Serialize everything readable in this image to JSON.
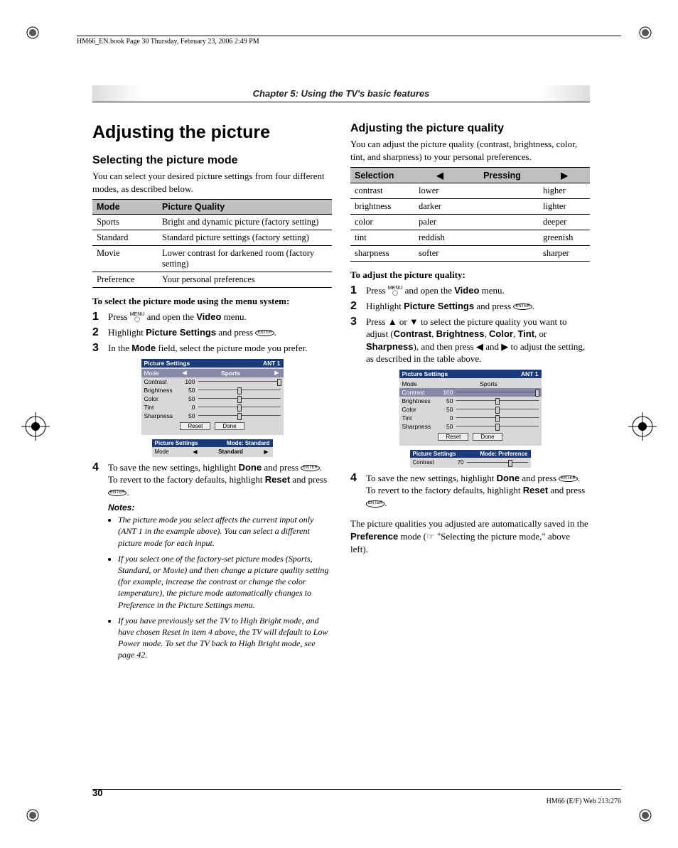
{
  "header_line": "HM66_EN.book  Page 30  Thursday, February 23, 2006  2:49 PM",
  "chapter": "Chapter 5: Using the TV's basic features",
  "page_number": "30",
  "footer_right": "HM66 (E/F) Web 213:276",
  "left": {
    "h1": "Adjusting the picture",
    "h2": "Selecting the picture mode",
    "intro": "You can select your desired picture settings from four different modes, as described below.",
    "table_headers": {
      "c1": "Mode",
      "c2": "Picture Quality"
    },
    "table_rows": [
      {
        "c1": "Sports",
        "c2": "Bright and dynamic picture (factory setting)"
      },
      {
        "c1": "Standard",
        "c2": "Standard picture settings (factory setting)"
      },
      {
        "c1": "Movie",
        "c2": "Lower contrast for darkened room (factory setting)"
      },
      {
        "c1": "Preference",
        "c2": "Your personal preferences"
      }
    ],
    "howto_head": "To select the picture mode using the menu system:",
    "steps": {
      "s1a": "Press ",
      "s1b": " and open the ",
      "s1c": "Video",
      "s1d": " menu.",
      "s2a": "Highlight ",
      "s2b": "Picture Settings",
      "s2c": " and press ",
      "s3a": "In the ",
      "s3b": "Mode",
      "s3c": " field, select the picture mode you prefer.",
      "s4a": "To save the new settings, highlight ",
      "s4b": "Done",
      "s4c": " and press ",
      "s4d": ". To revert to the factory defaults, highlight ",
      "s4e": "Reset",
      "s4f": " and press "
    },
    "notes_head": "Notes:",
    "notes": [
      "The picture mode you select affects the current input only (ANT 1 in the example above). You can select a different picture mode for each input.",
      "If you select one of the factory-set picture modes (Sports, Standard, or Movie) and then change a picture quality setting (for example, increase the contrast or change the color temperature), the picture mode automatically changes to Preference in the Picture Settings menu.",
      "If you have previously set the TV to High Bright mode, and have chosen Reset in item 4 above, the TV will default to Low Power mode. To set the TV back to High Bright mode, see page 42."
    ],
    "osd1": {
      "title_l": "Picture Settings",
      "title_r": "ANT 1",
      "rows": [
        {
          "lab": "Mode",
          "val": "",
          "mode_val": "Sports"
        },
        {
          "lab": "Contrast",
          "val": "100",
          "pos": 100
        },
        {
          "lab": "Brightness",
          "val": "50",
          "pos": 50
        },
        {
          "lab": "Color",
          "val": "50",
          "pos": 50
        },
        {
          "lab": "Tint",
          "val": "0",
          "pos": 50
        },
        {
          "lab": "Sharpness",
          "val": "50",
          "pos": 50
        }
      ],
      "btn_reset": "Reset",
      "btn_done": "Done"
    },
    "osd1b": {
      "title_l": "Picture Settings",
      "title_r": "Mode: Standard",
      "row_lab": "Mode",
      "row_val": "Standard"
    }
  },
  "right": {
    "h2": "Adjusting the picture quality",
    "intro": "You can adjust the picture quality (contrast, brightness, color, tint, and sharpness) to your personal preferences.",
    "table_headers": {
      "c1": "Selection",
      "c2": "◀",
      "c3": "Pressing",
      "c4": "▶"
    },
    "table_rows": [
      {
        "c1": "contrast",
        "c2": "lower",
        "c3": "higher"
      },
      {
        "c1": "brightness",
        "c2": "darker",
        "c3": "lighter"
      },
      {
        "c1": "color",
        "c2": "paler",
        "c3": "deeper"
      },
      {
        "c1": "tint",
        "c2": "reddish",
        "c3": "greenish"
      },
      {
        "c1": "sharpness",
        "c2": "softer",
        "c3": "sharper"
      }
    ],
    "howto_head": "To adjust the picture quality:",
    "steps": {
      "s1a": "Press ",
      "s1b": " and open the ",
      "s1c": "Video",
      "s1d": " menu.",
      "s2a": "Highlight ",
      "s2b": "Picture Settings",
      "s2c": " and press ",
      "s3a": "Press ",
      "s3b": " or ",
      "s3c": " to select the picture quality you want to adjust (",
      "s3d": "Contrast",
      "s3e": ", ",
      "s3f": "Brightness",
      "s3g": ", ",
      "s3h": "Color",
      "s3i": ", ",
      "s3j": "Tint",
      "s3k": ", or ",
      "s3l": "Sharpness",
      "s3m": "), and then press ",
      "s3n": " and ",
      "s3o": " to adjust the setting, as described in the table above.",
      "s4a": "To save the new settings, highlight ",
      "s4b": "Done",
      "s4c": " and press ",
      "s4d": ". To revert to the factory defaults, highlight ",
      "s4e": "Reset",
      "s4f": " and press "
    },
    "tail1": "The picture qualities you adjusted are automatically saved in the ",
    "tail2": "Preference",
    "tail3": " mode (☞ \"Selecting the picture mode,\" above left).",
    "osd2": {
      "title_l": "Picture Settings",
      "title_r": "ANT 1",
      "rows": [
        {
          "lab": "Mode",
          "mode_val": "Sports"
        },
        {
          "lab": "Contrast",
          "val": "100",
          "pos": 100,
          "hl": true
        },
        {
          "lab": "Brightness",
          "val": "50",
          "pos": 50
        },
        {
          "lab": "Color",
          "val": "50",
          "pos": 50
        },
        {
          "lab": "Tint",
          "val": "0",
          "pos": 50
        },
        {
          "lab": "Sharpness",
          "val": "50",
          "pos": 50
        }
      ],
      "btn_reset": "Reset",
      "btn_done": "Done"
    },
    "osd2b": {
      "title_l": "Picture Settings",
      "title_r": "Mode: Preference",
      "row_lab": "Contrast",
      "row_val": "70"
    }
  }
}
